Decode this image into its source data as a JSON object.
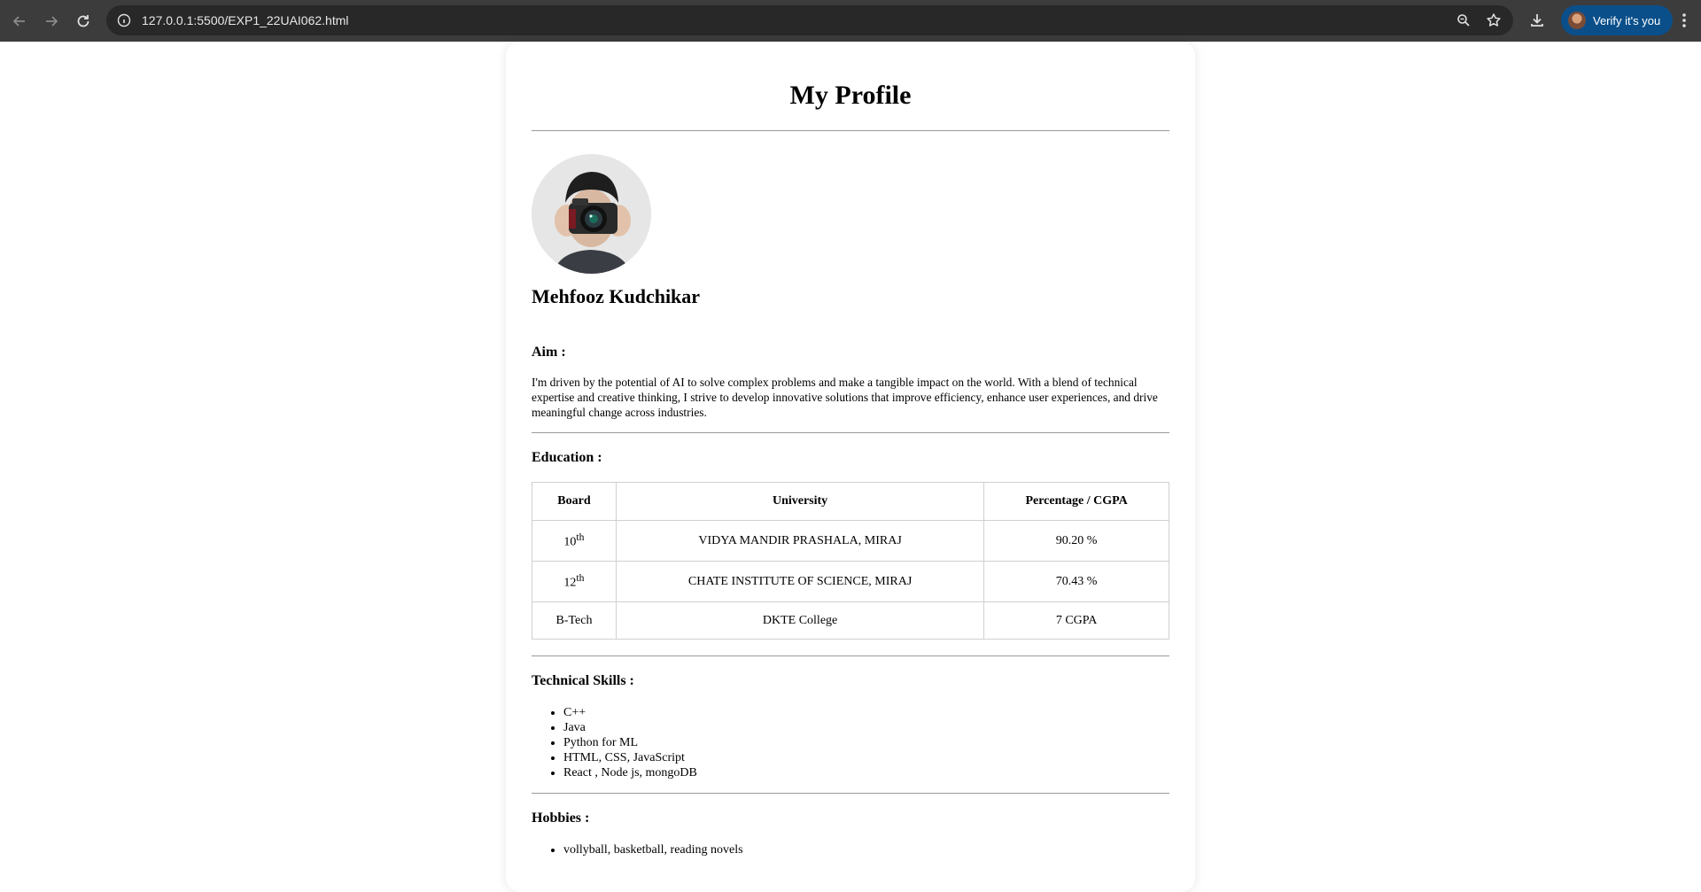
{
  "browser": {
    "url": "127.0.0.1:5500/EXP1_22UAI062.html",
    "profile_button": "Verify it's you",
    "icons": [
      "back-icon",
      "forward-icon",
      "reload-icon",
      "site-info-icon",
      "zoom-icon",
      "bookmark-star-icon",
      "download-icon",
      "menu-dots-icon"
    ]
  },
  "profile": {
    "title": "My Profile",
    "name": "Mehfooz Kudchikar",
    "aim": {
      "heading": "Aim :",
      "text": "I'm driven by the potential of AI to solve complex problems and make a tangible impact on the world. With a blend of technical expertise and creative thinking, I strive to develop innovative solutions that improve efficiency, enhance user experiences, and drive meaningful change across industries."
    },
    "education": {
      "heading": "Education :",
      "columns": [
        "Board",
        "University",
        "Percentage / CGPA"
      ],
      "rows": [
        {
          "board": "10",
          "sup": "th",
          "university": "VIDYA MANDIR PRASHALA, MIRAJ",
          "score": "90.20 %"
        },
        {
          "board": "12",
          "sup": "th",
          "university": "CHATE INSTITUTE OF SCIENCE, MIRAJ",
          "score": "70.43 %"
        },
        {
          "board": "B-Tech",
          "sup": "",
          "university": "DKTE College",
          "score": "7 CGPA"
        }
      ]
    },
    "skills": {
      "heading": "Technical Skills :",
      "items": [
        "C++",
        "Java",
        "Python for ML",
        "HTML, CSS, JavaScript",
        "React , Node js, mongoDB"
      ]
    },
    "hobbies": {
      "heading": "Hobbies :",
      "items": [
        "vollyball, basketball, reading novels"
      ]
    }
  }
}
